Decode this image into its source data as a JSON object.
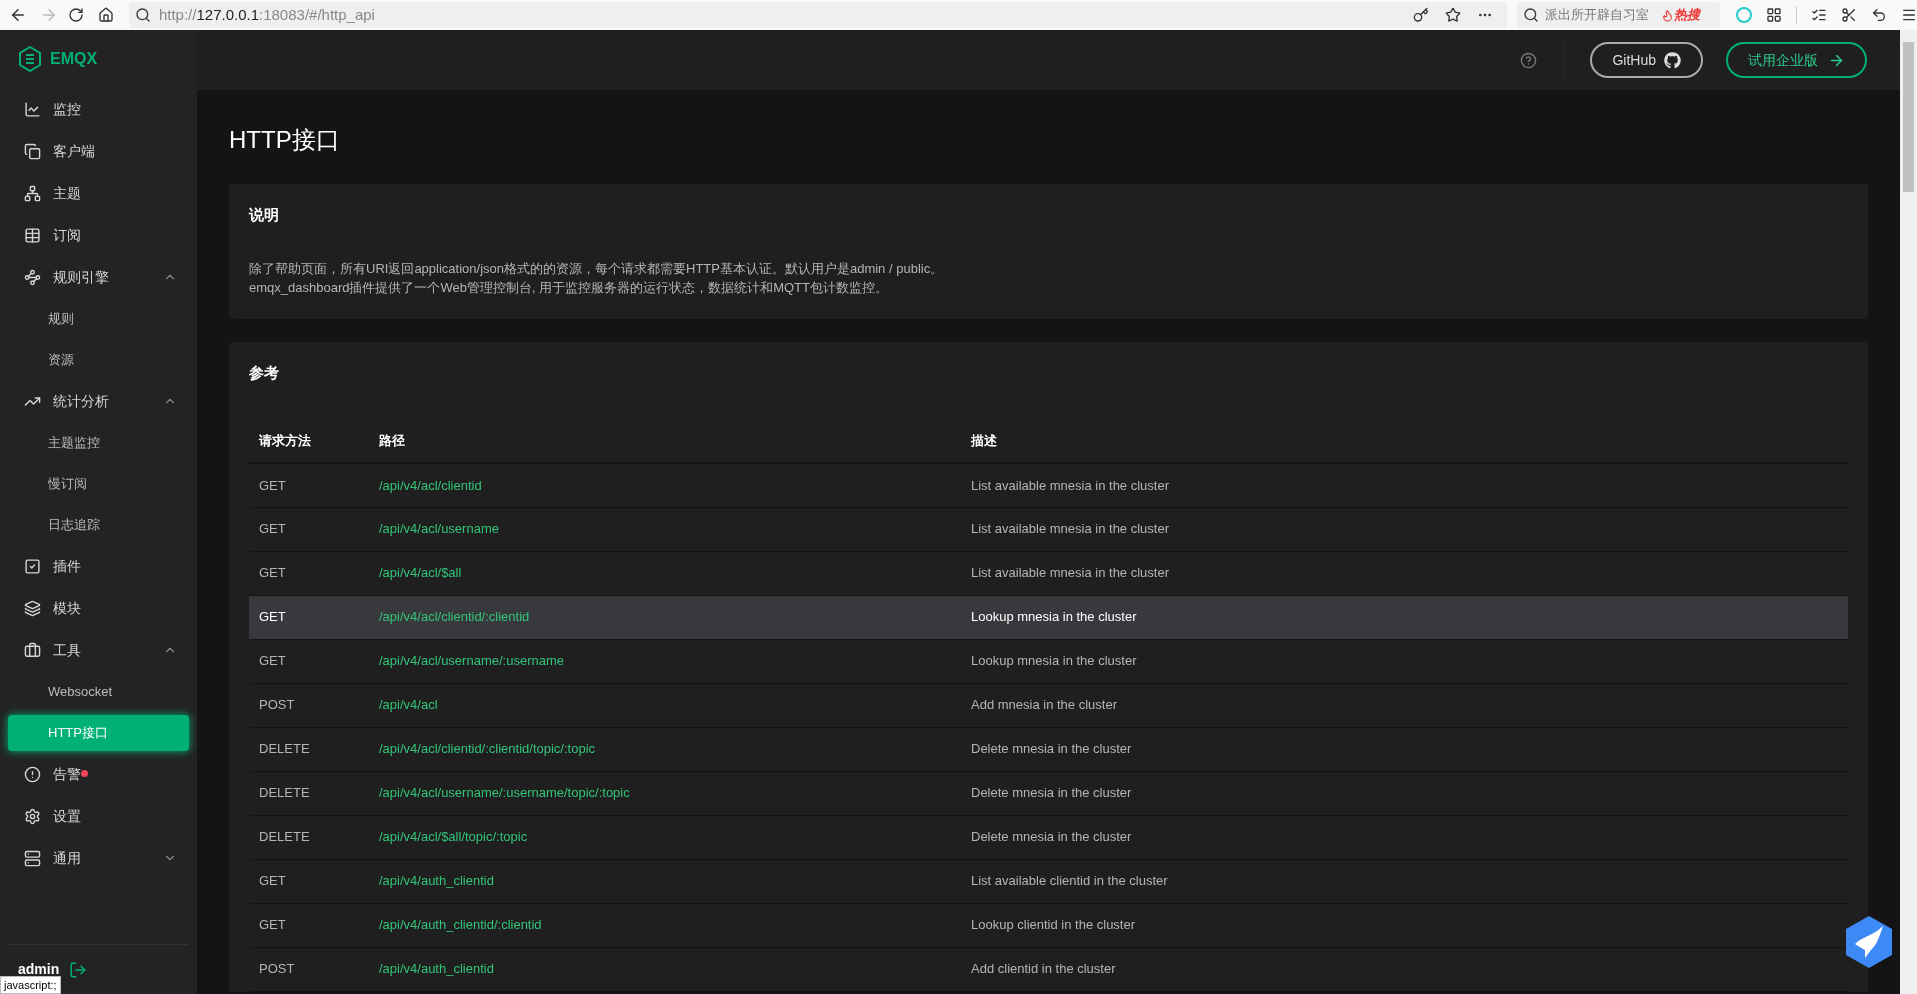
{
  "browser": {
    "url_host": "127.0.0.1",
    "url_prefix": "http://",
    "url_rest": ":18083/#/http_api",
    "search_placeholder": "派出所开辟自习室",
    "hot_label": "热搜",
    "status_text": "javascript:;"
  },
  "sidebar": {
    "logo": "EMQX",
    "user": "admin",
    "items": [
      {
        "label": "监控",
        "selected": false
      },
      {
        "label": "客户端",
        "selected": false
      },
      {
        "label": "主题",
        "selected": false
      },
      {
        "label": "订阅",
        "selected": false
      },
      {
        "label": "规则引擎",
        "selected": false,
        "expanded": true,
        "children": [
          {
            "label": "规则",
            "selected": false
          },
          {
            "label": "资源",
            "selected": false
          }
        ]
      },
      {
        "label": "统计分析",
        "selected": false,
        "expanded": true,
        "children": [
          {
            "label": "主题监控",
            "selected": false
          },
          {
            "label": "慢订阅",
            "selected": false
          },
          {
            "label": "日志追踪",
            "selected": false
          }
        ]
      },
      {
        "label": "插件",
        "selected": false
      },
      {
        "label": "模块",
        "selected": false
      },
      {
        "label": "工具",
        "selected": false,
        "expanded": true,
        "children": [
          {
            "label": "Websocket",
            "selected": false
          },
          {
            "label": "HTTP接口",
            "selected": true
          }
        ]
      },
      {
        "label": "告警",
        "selected": false,
        "alert": true
      },
      {
        "label": "设置",
        "selected": false
      },
      {
        "label": "通用",
        "selected": false,
        "expanded": false
      }
    ]
  },
  "header": {
    "github_label": "GitHub",
    "enterprise_label": "试用企业版"
  },
  "page": {
    "title": "HTTP接口",
    "intro": {
      "title": "说明",
      "lines": [
        "除了帮助页面，所有URI返回application/json格式的的资源，每个请求都需要HTTP基本认证。默认用户是admin / public。",
        "emqx_dashboard插件提供了一个Web管理控制台, 用于监控服务器的运行状态，数据统计和MQTT包计数监控。"
      ]
    },
    "reference": {
      "title": "参考",
      "columns": [
        "请求方法",
        "路径",
        "描述"
      ],
      "rows": [
        {
          "method": "GET",
          "path": "/api/v4/acl/clientid",
          "description": "List available mnesia in the cluster",
          "selected": false
        },
        {
          "method": "GET",
          "path": "/api/v4/acl/username",
          "description": "List available mnesia in the cluster",
          "selected": false
        },
        {
          "method": "GET",
          "path": "/api/v4/acl/$all",
          "description": "List available mnesia in the cluster",
          "selected": false
        },
        {
          "method": "GET",
          "path": "/api/v4/acl/clientid/:clientid",
          "description": "Lookup mnesia in the cluster",
          "selected": true
        },
        {
          "method": "GET",
          "path": "/api/v4/acl/username/:username",
          "description": "Lookup mnesia in the cluster",
          "selected": false
        },
        {
          "method": "POST",
          "path": "/api/v4/acl",
          "description": "Add mnesia in the cluster",
          "selected": false
        },
        {
          "method": "DELETE",
          "path": "/api/v4/acl/clientid/:clientid/topic/:topic",
          "description": "Delete mnesia in the cluster",
          "selected": false
        },
        {
          "method": "DELETE",
          "path": "/api/v4/acl/username/:username/topic/:topic",
          "description": "Delete mnesia in the cluster",
          "selected": false
        },
        {
          "method": "DELETE",
          "path": "/api/v4/acl/$all/topic/:topic",
          "description": "Delete mnesia in the cluster",
          "selected": false
        },
        {
          "method": "GET",
          "path": "/api/v4/auth_clientid",
          "description": "List available clientid in the cluster",
          "selected": false
        },
        {
          "method": "GET",
          "path": "/api/v4/auth_clientid/:clientid",
          "description": "Lookup clientid in the cluster",
          "selected": false
        },
        {
          "method": "POST",
          "path": "/api/v4/auth_clientid",
          "description": "Add clientid in the cluster",
          "selected": false
        }
      ]
    }
  }
}
